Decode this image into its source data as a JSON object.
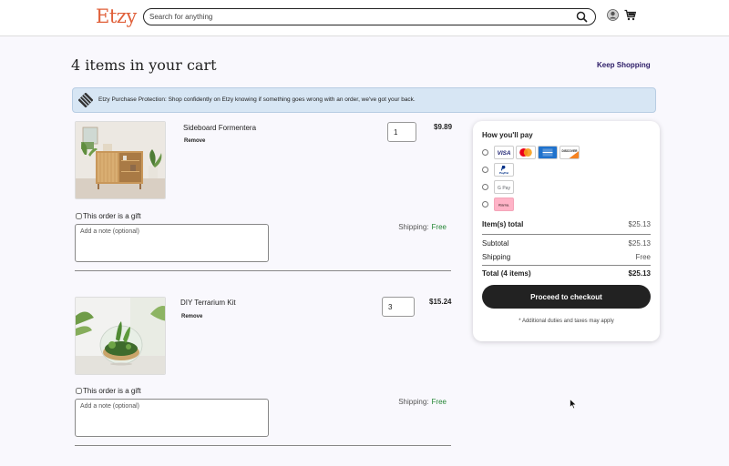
{
  "header": {
    "logo": "Etzy",
    "search_placeholder": "Search for anything",
    "icons": [
      "search-icon",
      "account-icon",
      "cart-icon"
    ]
  },
  "page": {
    "title": "4 items in your cart",
    "keep_shopping": "Keep Shopping"
  },
  "banner": {
    "text": "Etzy Purchase Protection: Shop confidently on Etzy knowing if something goes wrong with an order, we've got your back."
  },
  "items": [
    {
      "name": "Sideboard Formentera",
      "remove": "Remove",
      "quantity": "1",
      "price": "$9.89",
      "gift_label": "This order is a gift",
      "shipping_label": "Shipping:",
      "shipping_value": "Free",
      "note_placeholder": "Add a note (optional)",
      "image": "sideboard-photo"
    },
    {
      "name": "DIY Terrarium Kit",
      "remove": "Remove",
      "quantity": "3",
      "price": "$15.24",
      "gift_label": "This order is a gift",
      "shipping_label": "Shipping:",
      "shipping_value": "Free",
      "note_placeholder": "Add a note (optional)",
      "image": "terrarium-photo"
    }
  ],
  "payment": {
    "title": "How you'll pay",
    "methods": [
      {
        "id": "cards",
        "cards": [
          "VISA",
          "Mastercard",
          "American Express",
          "DISCOVER"
        ]
      },
      {
        "id": "paypal",
        "label": "PayPal"
      },
      {
        "id": "gpay",
        "label": "G Pay"
      },
      {
        "id": "klarna",
        "label": "Klarna."
      }
    ],
    "items_total_label": "Item(s) total",
    "items_total_value": "$25.13",
    "subtotal_label": "Subtotal",
    "subtotal_value": "$25.13",
    "shipping_label": "Shipping",
    "shipping_value": "Free",
    "total_label": "Total (4 items)",
    "total_value": "$25.13",
    "checkout_label": "Proceed to checkout",
    "duties_note": "* Additional duties and taxes may apply"
  },
  "colors": {
    "brand": "#e0603a",
    "banner_bg": "#d7e6f4",
    "link": "#2b1b66",
    "free_shipping": "#258635",
    "checkout_bg": "#222222"
  }
}
